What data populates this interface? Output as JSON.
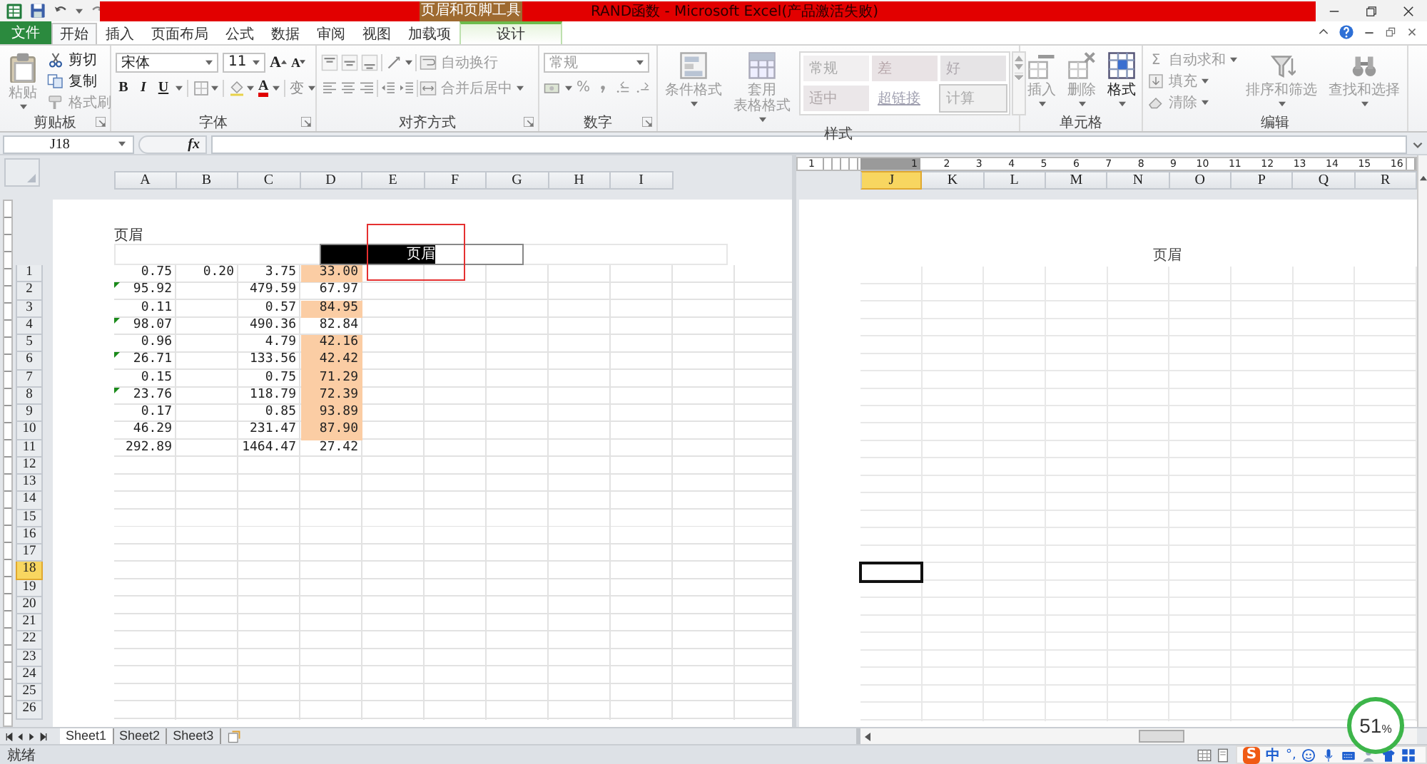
{
  "title_bar": {
    "title": "RAND函数 - Microsoft Excel(产品激活失败)",
    "context_tab": "页眉和页脚工具"
  },
  "tabs": [
    {
      "label": "文件",
      "kind": "file",
      "selected": false
    },
    {
      "label": "开始",
      "kind": "main",
      "selected": true
    },
    {
      "label": "插入",
      "kind": "main",
      "selected": false
    },
    {
      "label": "页面布局",
      "kind": "main",
      "selected": false
    },
    {
      "label": "公式",
      "kind": "main",
      "selected": false
    },
    {
      "label": "数据",
      "kind": "main",
      "selected": false
    },
    {
      "label": "审阅",
      "kind": "main",
      "selected": false
    },
    {
      "label": "视图",
      "kind": "main",
      "selected": false
    },
    {
      "label": "加载项",
      "kind": "main",
      "selected": false
    },
    {
      "label": "设计",
      "kind": "context",
      "selected": false
    }
  ],
  "ribbon": [
    {
      "kind": "clipboard",
      "label": "剪贴板",
      "launcher": true,
      "large": {
        "label": "粘贴",
        "disabled": true
      },
      "small": [
        {
          "label": "剪切",
          "kind": "cut",
          "disabled": false
        },
        {
          "label": "复制",
          "kind": "copy",
          "disabled": false
        },
        {
          "label": "格式刷",
          "kind": "painter",
          "disabled": true
        }
      ]
    },
    {
      "kind": "font",
      "label": "字体",
      "launcher": true,
      "font": "宋体",
      "size": "11",
      "grow": "A",
      "shrink": "A",
      "styles": [
        {
          "label": "B",
          "kind": "bold"
        },
        {
          "label": "I",
          "kind": "italic"
        },
        {
          "label": "U",
          "kind": "underline"
        }
      ],
      "color_button": "A",
      "phonetic": "变"
    },
    {
      "kind": "align",
      "label": "对齐方式",
      "launcher": true,
      "items": [
        {
          "label": "自动换行",
          "disabled": true
        },
        {
          "label": "合并后居中",
          "disabled": true
        }
      ]
    },
    {
      "kind": "number",
      "label": "数字",
      "launcher": true,
      "format": "常规",
      "disabled": true,
      "percent": "%"
    },
    {
      "kind": "styles",
      "label": "样式",
      "items": [
        {
          "lines": [
            "条件格式"
          ],
          "kind": "conditional",
          "disabled": true
        },
        {
          "lines": [
            "套用",
            "表格格式"
          ],
          "kind": "table",
          "disabled": true
        }
      ],
      "gallery": [
        {
          "label": "常规"
        },
        {
          "label": "差"
        },
        {
          "label": "好"
        },
        {
          "label": "适中"
        },
        {
          "label": "超链接"
        },
        {
          "label": "计算"
        }
      ]
    },
    {
      "kind": "cells",
      "label": "单元格",
      "items": [
        {
          "label": "插入",
          "kind": "insert",
          "disabled": true
        },
        {
          "label": "删除",
          "kind": "delete",
          "disabled": true
        },
        {
          "label": "格式",
          "kind": "format",
          "disabled": false
        }
      ]
    },
    {
      "kind": "editing",
      "label": "编辑",
      "small": [
        {
          "label": "自动求和",
          "kind": "sum",
          "symbol": "Σ",
          "disabled": true
        },
        {
          "label": "填充",
          "kind": "fill",
          "disabled": true
        },
        {
          "label": "清除",
          "kind": "clear",
          "disabled": true
        }
      ],
      "large": [
        {
          "label": "排序和筛选",
          "kind": "sort",
          "disabled": true
        },
        {
          "label": "查找和选择",
          "kind": "find",
          "disabled": true
        }
      ]
    }
  ],
  "formula_bar": {
    "name_box": "J18",
    "function_label": "fx"
  },
  "sheet": {
    "ruler": [
      "1",
      "1",
      "2",
      "3",
      "4",
      "5",
      "6",
      "7",
      "8",
      "9",
      "10",
      "11",
      "12",
      "13",
      "14",
      "15",
      "16"
    ],
    "left_columns": [
      {
        "label": "A",
        "selected": false
      },
      {
        "label": "B",
        "selected": false
      },
      {
        "label": "C",
        "selected": false
      },
      {
        "label": "D",
        "selected": false
      },
      {
        "label": "E",
        "selected": false
      },
      {
        "label": "F",
        "selected": false
      },
      {
        "label": "G",
        "selected": false
      },
      {
        "label": "H",
        "selected": false
      },
      {
        "label": "I",
        "selected": false
      }
    ],
    "right_columns": [
      {
        "label": "J",
        "selected": true
      },
      {
        "label": "K",
        "selected": false
      },
      {
        "label": "L",
        "selected": false
      },
      {
        "label": "M",
        "selected": false
      },
      {
        "label": "N",
        "selected": false
      },
      {
        "label": "O",
        "selected": false
      },
      {
        "label": "P",
        "selected": false
      },
      {
        "label": "Q",
        "selected": false
      },
      {
        "label": "R",
        "selected": false
      }
    ],
    "rows": [
      {
        "label": "1",
        "selected": false
      },
      {
        "label": "2",
        "selected": false
      },
      {
        "label": "3",
        "selected": false
      },
      {
        "label": "4",
        "selected": false
      },
      {
        "label": "5",
        "selected": false
      },
      {
        "label": "6",
        "selected": false
      },
      {
        "label": "7",
        "selected": false
      },
      {
        "label": "8",
        "selected": false
      },
      {
        "label": "9",
        "selected": false
      },
      {
        "label": "10",
        "selected": false
      },
      {
        "label": "11",
        "selected": false
      },
      {
        "label": "12",
        "selected": false
      },
      {
        "label": "13",
        "selected": false
      },
      {
        "label": "14",
        "selected": false
      },
      {
        "label": "15",
        "selected": false
      },
      {
        "label": "16",
        "selected": false
      },
      {
        "label": "17",
        "selected": false
      },
      {
        "label": "18",
        "selected": true
      },
      {
        "label": "19",
        "selected": false
      },
      {
        "label": "20",
        "selected": false
      },
      {
        "label": "21",
        "selected": false
      },
      {
        "label": "22",
        "selected": false
      },
      {
        "label": "23",
        "selected": false
      },
      {
        "label": "24",
        "selected": false
      },
      {
        "label": "25",
        "selected": false
      },
      {
        "label": "26",
        "selected": false
      }
    ],
    "header_label": "页眉",
    "header_edit": "页眉",
    "right_header": "页眉",
    "data": [
      {
        "cells": [
          "0.75",
          "0.20",
          "3.75",
          "33.00"
        ],
        "highlight": true,
        "error_flag": false
      },
      {
        "cells": [
          "95.92",
          null,
          "479.59",
          "67.97"
        ],
        "highlight": false,
        "error_flag": true
      },
      {
        "cells": [
          "0.11",
          null,
          "0.57",
          "84.95"
        ],
        "highlight": true,
        "error_flag": false
      },
      {
        "cells": [
          "98.07",
          null,
          "490.36",
          "82.84"
        ],
        "highlight": false,
        "error_flag": true
      },
      {
        "cells": [
          "0.96",
          null,
          "4.79",
          "42.16"
        ],
        "highlight": true,
        "error_flag": false
      },
      {
        "cells": [
          "26.71",
          null,
          "133.56",
          "42.42"
        ],
        "highlight": true,
        "error_flag": true
      },
      {
        "cells": [
          "0.15",
          null,
          "0.75",
          "71.29"
        ],
        "highlight": true,
        "error_flag": false
      },
      {
        "cells": [
          "23.76",
          null,
          "118.79",
          "72.39"
        ],
        "highlight": true,
        "error_flag": true
      },
      {
        "cells": [
          "0.17",
          null,
          "0.85",
          "93.89"
        ],
        "highlight": true,
        "error_flag": false
      },
      {
        "cells": [
          "46.29",
          null,
          "231.47",
          "87.90"
        ],
        "highlight": true,
        "error_flag": false
      },
      {
        "cells": [
          "292.89",
          null,
          "1464.47",
          "27.42"
        ],
        "highlight": false,
        "error_flag": false
      }
    ]
  },
  "sheet_tabs": [
    {
      "label": "Sheet1",
      "selected": true
    },
    {
      "label": "Sheet2",
      "selected": false
    },
    {
      "label": "Sheet3",
      "selected": false
    }
  ],
  "status_bar": {
    "text": "就绪"
  },
  "ime_bar": {
    "logo": "S",
    "mode": "中",
    "punct": "°,"
  },
  "speed_ball": {
    "value": "51",
    "unit": "%"
  }
}
